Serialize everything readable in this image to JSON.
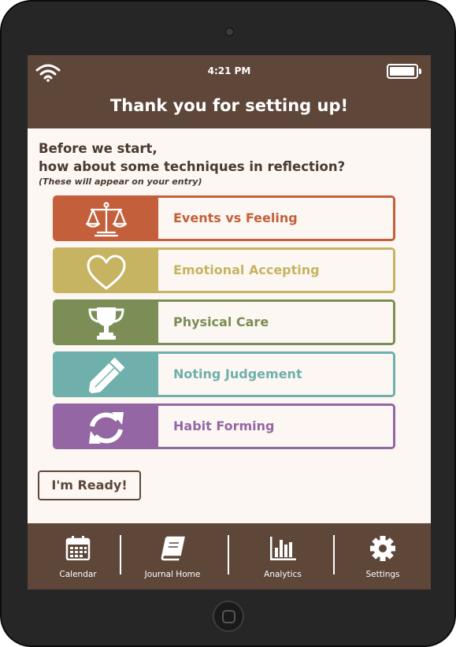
{
  "status_bar": {
    "time": "4:21 PM"
  },
  "header": {
    "title": "Thank you for setting up!"
  },
  "intro": {
    "line1": "Before we start,",
    "line2": "how about some techniques in reflection?",
    "note": "(These will appear on your entry)"
  },
  "techniques": [
    {
      "label": "Events vs Feeling",
      "icon": "balance-scale-icon",
      "color": "#c45f3c"
    },
    {
      "label": "Emotional Accepting",
      "icon": "heart-icon",
      "color": "#c6b462"
    },
    {
      "label": "Physical Care",
      "icon": "trophy-icon",
      "color": "#7b8e55"
    },
    {
      "label": "Noting Judgement",
      "icon": "pencil-icon",
      "color": "#6fb0ac"
    },
    {
      "label": "Habit Forming",
      "icon": "refresh-icon",
      "color": "#9467a4"
    }
  ],
  "ready_button": {
    "label": "I'm Ready!"
  },
  "tabs": [
    {
      "label": "Calendar",
      "icon": "calendar-icon"
    },
    {
      "label": "Journal Home",
      "icon": "book-icon"
    },
    {
      "label": "Analytics",
      "icon": "bar-chart-icon"
    },
    {
      "label": "Settings",
      "icon": "gear-icon"
    }
  ],
  "colors": {
    "brand_brown": "#5e4639",
    "background": "#fcf7f2"
  }
}
